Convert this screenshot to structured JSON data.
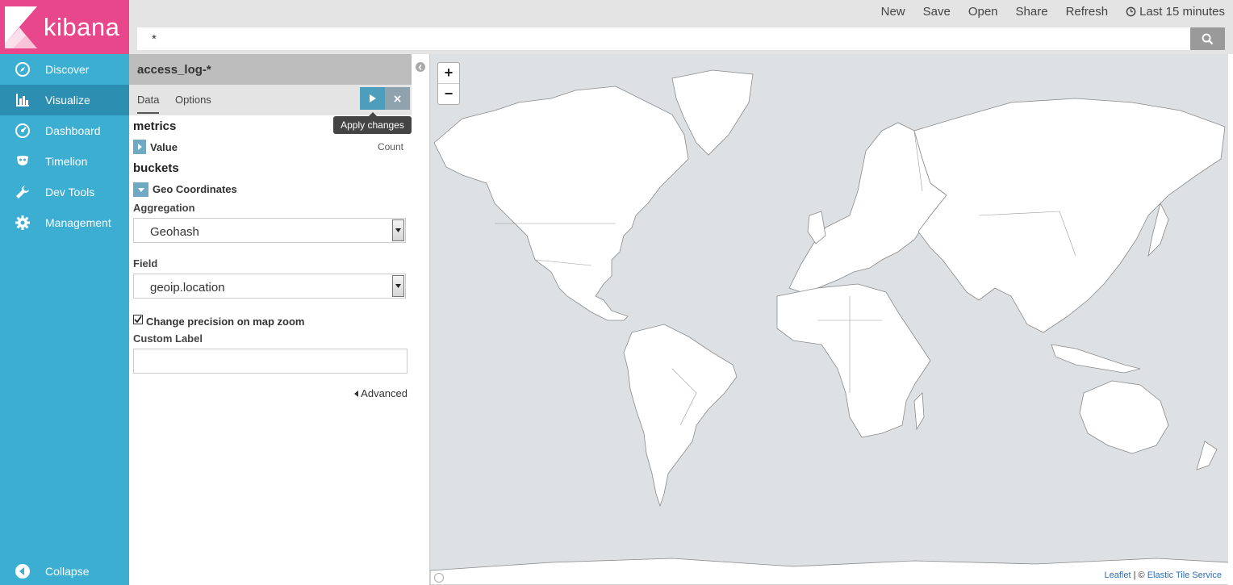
{
  "app": {
    "brand": "kibana"
  },
  "sidebar": {
    "items": [
      {
        "label": "Discover",
        "icon": "compass-icon"
      },
      {
        "label": "Visualize",
        "icon": "bar-chart-icon"
      },
      {
        "label": "Dashboard",
        "icon": "gauge-icon"
      },
      {
        "label": "Timelion",
        "icon": "mask-icon"
      },
      {
        "label": "Dev Tools",
        "icon": "wrench-icon"
      },
      {
        "label": "Management",
        "icon": "gear-icon"
      }
    ],
    "active": "Visualize",
    "collapse_label": "Collapse"
  },
  "topnav": {
    "new": "New",
    "save": "Save",
    "open": "Open",
    "share": "Share",
    "refresh": "Refresh",
    "time": "Last 15 minutes"
  },
  "search": {
    "query": "*"
  },
  "editor": {
    "index_pattern": "access_log-*",
    "tabs": [
      "Data",
      "Options"
    ],
    "active_tab": "Data",
    "apply_tooltip": "Apply changes",
    "metrics_title": "metrics",
    "metric": {
      "label": "Value",
      "value": "Count"
    },
    "buckets_title": "buckets",
    "bucket": {
      "label": "Geo Coordinates",
      "aggregation_label": "Aggregation",
      "aggregation_value": "Geohash",
      "field_label": "Field",
      "field_value": "geoip.location",
      "precision_label": "Change precision on map zoom",
      "precision_checked": true,
      "custom_label_label": "Custom Label",
      "custom_label_value": "",
      "advanced_label": "Advanced"
    }
  },
  "map": {
    "zoom_in": "+",
    "zoom_out": "−",
    "attribution_leaflet": "Leaflet",
    "attribution_sep": " | © ",
    "attribution_tiles": "Elastic Tile Service"
  },
  "colors": {
    "sidebar": "#3caed2",
    "sidebar_active": "#2c8fb2",
    "logo_bg": "#e8488b",
    "apply_button": "#4d9dbd",
    "map_water": "#dde1e4",
    "map_land": "#ffffff"
  }
}
